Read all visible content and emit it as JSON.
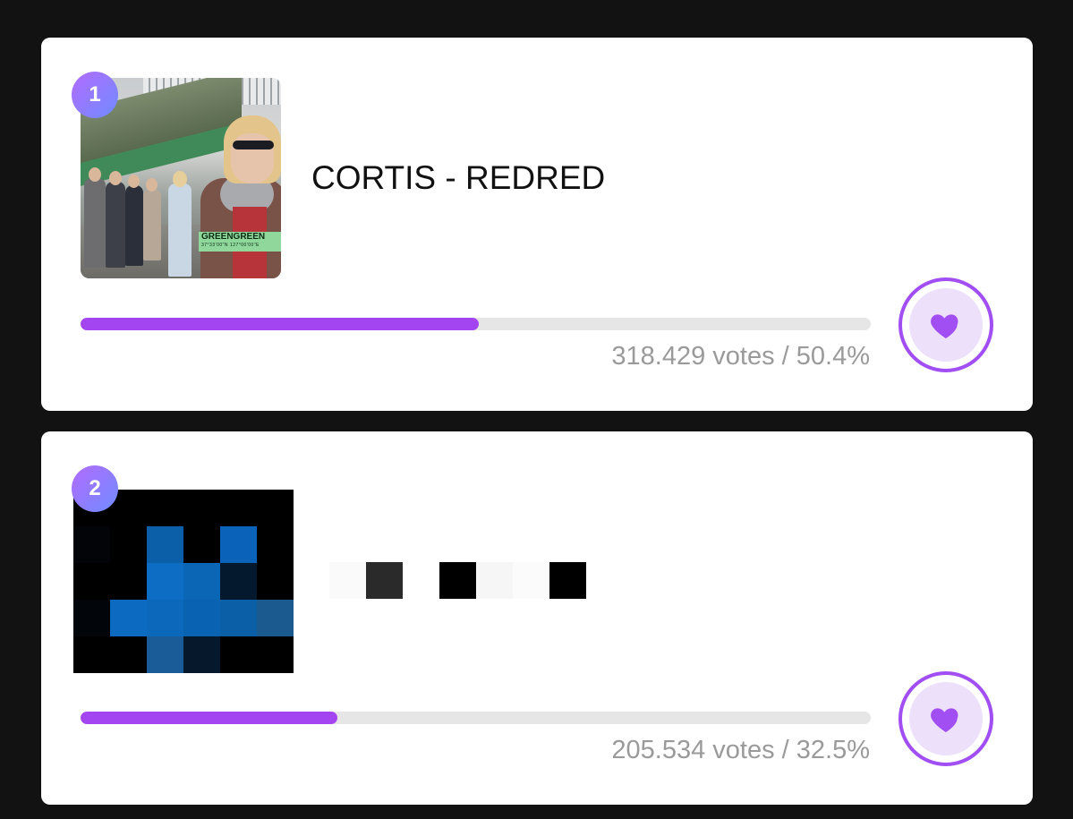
{
  "entries": [
    {
      "rank": "1",
      "title": "CORTIS - REDRED",
      "art_label": "GREENGREEN",
      "art_sublabel": "37°33'00\"N  127°00'00\"E",
      "votes_text": "318.429 votes / 50.4%",
      "percent": 50.4,
      "vote_icon": "heart-icon"
    },
    {
      "rank": "2",
      "title_censored": true,
      "votes_text": "205.534 votes / 32.5%",
      "percent": 32.5,
      "vote_icon": "heart-icon"
    }
  ],
  "colors": {
    "accent": "#a445f2",
    "badge_start": "#b36bff",
    "badge_end": "#6e8cff",
    "track": "#e6e6e6",
    "vote_text": "#9a9a9a"
  }
}
